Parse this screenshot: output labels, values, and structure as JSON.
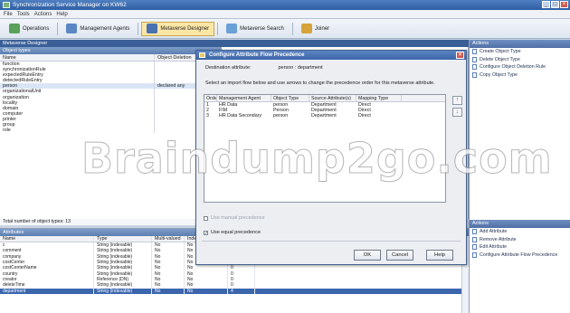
{
  "window": {
    "title": "Synchronization Service Manager on KW62"
  },
  "menu": [
    "File",
    "Tools",
    "Actions",
    "Help"
  ],
  "toolbar": [
    {
      "label": "Operations",
      "icon": "operations-icon",
      "color": "#5aa15a"
    },
    {
      "label": "Management Agents",
      "icon": "management-agents-icon",
      "color": "#5b86c4"
    },
    {
      "label": "Metaverse Designer",
      "icon": "metaverse-designer-icon",
      "color": "#4a72b0",
      "active": true
    },
    {
      "label": "Metaverse Search",
      "icon": "metaverse-search-icon",
      "color": "#6aa0d6"
    },
    {
      "label": "Joiner",
      "icon": "joiner-icon",
      "color": "#d6a33a"
    }
  ],
  "subtitle": "Metaverse Designer",
  "object_types": {
    "header": "Object types",
    "columns": [
      "Name",
      "Object Deletion"
    ],
    "rows": [
      {
        "name": "function",
        "deletion": ""
      },
      {
        "name": "synchronizationRule",
        "deletion": ""
      },
      {
        "name": "expectedRuleEntry",
        "deletion": ""
      },
      {
        "name": "detectedRuleEntry",
        "deletion": ""
      },
      {
        "name": "person",
        "deletion": "declared any",
        "selected": true
      },
      {
        "name": "organizationalUnit",
        "deletion": ""
      },
      {
        "name": "organization",
        "deletion": ""
      },
      {
        "name": "locality",
        "deletion": ""
      },
      {
        "name": "domain",
        "deletion": ""
      },
      {
        "name": "computer",
        "deletion": ""
      },
      {
        "name": "printer",
        "deletion": ""
      },
      {
        "name": "group",
        "deletion": ""
      },
      {
        "name": "role",
        "deletion": ""
      }
    ],
    "footer": "Total number of object types: 13"
  },
  "attributes": {
    "header": "Attributes",
    "columns": [
      "Name",
      "Type",
      "Multi-valued",
      "Indexed",
      ""
    ],
    "rows": [
      {
        "name": "c",
        "type": "String (indexable)",
        "mv": "No",
        "idx": "No",
        "cnt": ""
      },
      {
        "name": "comment",
        "type": "String (indexable)",
        "mv": "No",
        "idx": "No",
        "cnt": ""
      },
      {
        "name": "company",
        "type": "String (indexable)",
        "mv": "No",
        "idx": "No",
        "cnt": ""
      },
      {
        "name": "costCenter",
        "type": "String (indexable)",
        "mv": "No",
        "idx": "No",
        "cnt": "0"
      },
      {
        "name": "costCenterName",
        "type": "String (indexable)",
        "mv": "No",
        "idx": "No",
        "cnt": "0"
      },
      {
        "name": "country",
        "type": "String (indexable)",
        "mv": "No",
        "idx": "No",
        "cnt": "0"
      },
      {
        "name": "creator",
        "type": "Reference (DN)",
        "mv": "No",
        "idx": "No",
        "cnt": "0"
      },
      {
        "name": "deleteTime",
        "type": "String (indexable)",
        "mv": "No",
        "idx": "No",
        "cnt": "0"
      },
      {
        "name": "department",
        "type": "String (indexable)",
        "mv": "No",
        "idx": "No",
        "cnt": "4",
        "selected": true
      }
    ]
  },
  "actions_top": {
    "header": "Actions",
    "items": [
      "Create Object Type",
      "Delete Object Type",
      "Configure Object Deletion Rule",
      "Copy Object Type"
    ]
  },
  "actions_bottom": {
    "header": "Actions",
    "items": [
      "Add Attribute",
      "Remove Attribute",
      "Edit Attribute",
      "Configure Attribute Flow Precedence"
    ]
  },
  "dialog": {
    "title": "Configure Attribute Flow Precedence",
    "dest_label": "Destination attribute:",
    "dest_value": "person : department",
    "instructions": "Select an import flow below and use arrows to change the precedence order for this metaverse attribute.",
    "columns": [
      "Order",
      "Management Agent",
      "Object Type",
      "Source Attribute(s)",
      "Mapping Type"
    ],
    "rows": [
      {
        "order": "1",
        "ma": "HR Data",
        "ot": "person",
        "src": "Department",
        "map": "Direct"
      },
      {
        "order": "2",
        "ma": "FIM",
        "ot": "Person",
        "src": "Department",
        "map": "Direct"
      },
      {
        "order": "3",
        "ma": "HR Data Secondary",
        "ot": "person",
        "src": "Department",
        "map": "Direct"
      }
    ],
    "manual_precedence": "Use manual precedence",
    "equal_precedence": "Use equal precedence",
    "ok": "OK",
    "cancel": "Cancel",
    "help": "Help"
  },
  "watermark": "Braindump2go.com"
}
